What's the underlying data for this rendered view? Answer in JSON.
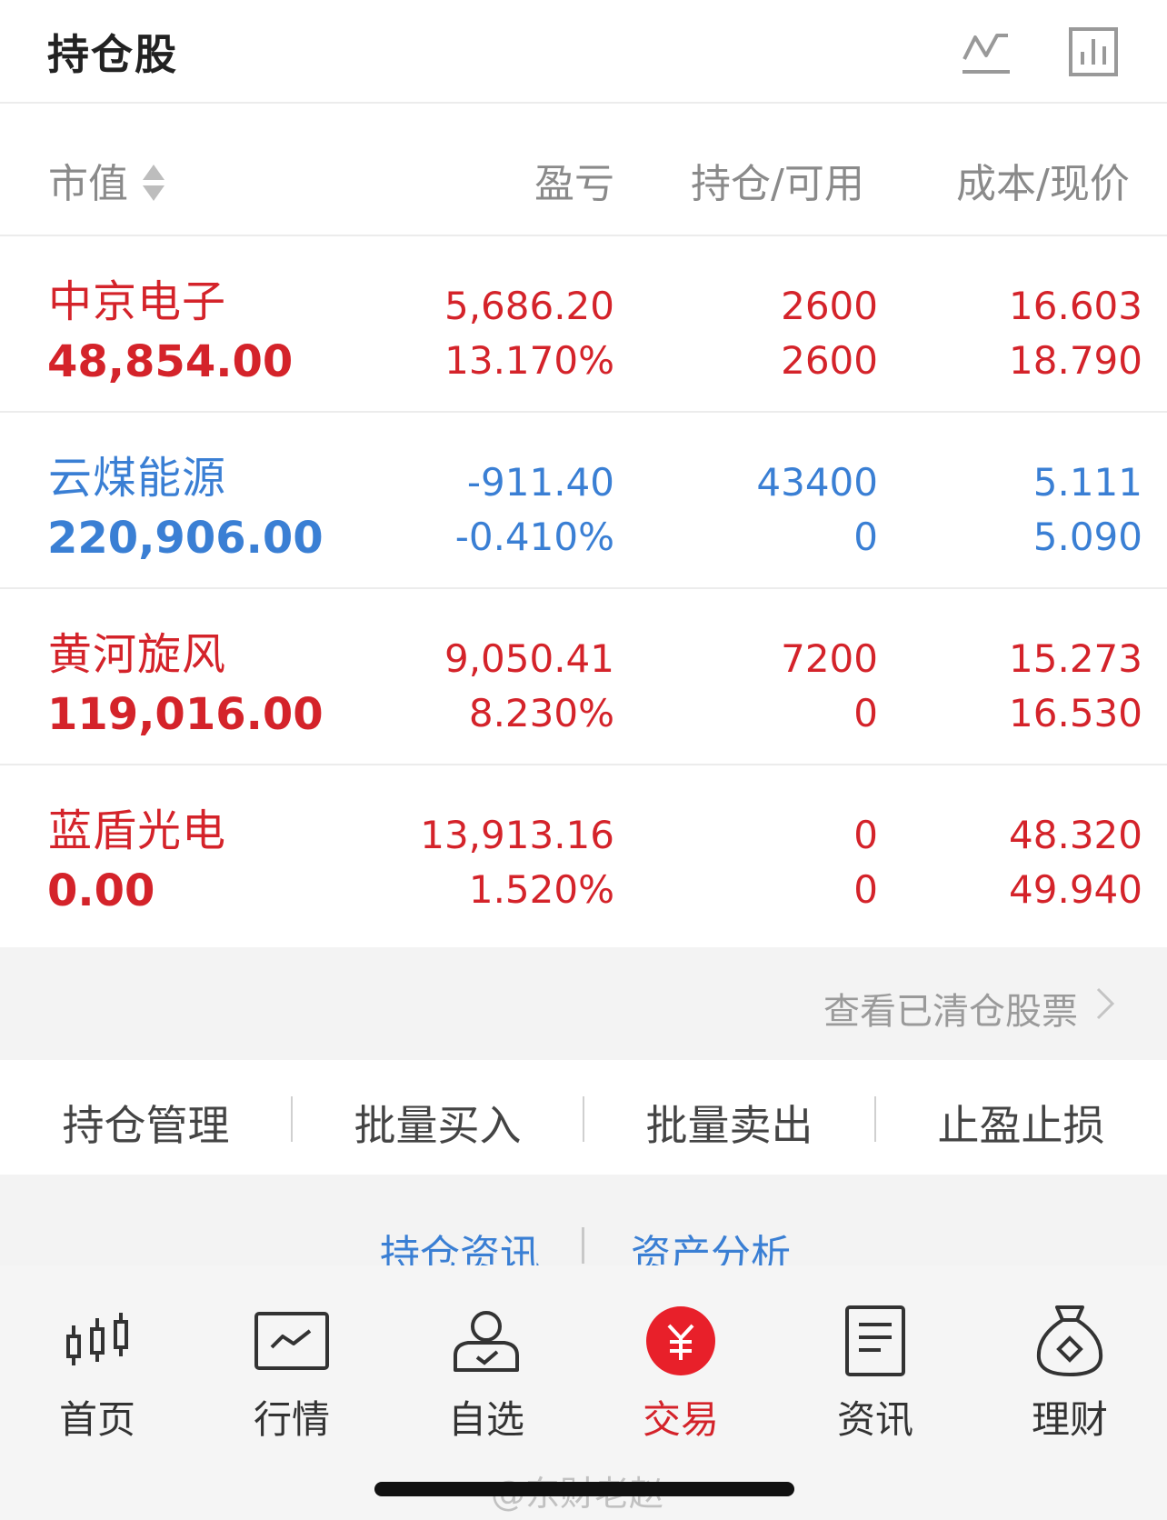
{
  "header": {
    "title": "持仓股",
    "icons": [
      "line-chart-icon",
      "bar-chart-icon"
    ]
  },
  "columns": {
    "market_value": "市值",
    "pnl": "盈亏",
    "position": "持仓/可用",
    "price": "成本/现价"
  },
  "colors": {
    "up": "#d4232a",
    "down": "#3a7fd4",
    "accent": "#e8202a"
  },
  "holdings": [
    {
      "name": "中京电子",
      "market_value": "48,854.00",
      "pnl": "5,686.20",
      "pnl_pct": "13.170%",
      "position": "2600",
      "available": "2600",
      "cost": "16.603",
      "price": "18.790",
      "trend": "up"
    },
    {
      "name": "云煤能源",
      "market_value": "220,906.00",
      "pnl": "-911.40",
      "pnl_pct": "-0.410%",
      "position": "43400",
      "available": "0",
      "cost": "5.111",
      "price": "5.090",
      "trend": "down"
    },
    {
      "name": "黄河旋风",
      "market_value": "119,016.00",
      "pnl": "9,050.41",
      "pnl_pct": "8.230%",
      "position": "7200",
      "available": "0",
      "cost": "15.273",
      "price": "16.530",
      "trend": "up"
    },
    {
      "name": "蓝盾光电",
      "market_value": "0.00",
      "pnl": "13,913.16",
      "pnl_pct": "1.520%",
      "position": "0",
      "available": "0",
      "cost": "48.320",
      "price": "49.940",
      "trend": "up"
    }
  ],
  "cleared_link": "查看已清仓股票",
  "actions": [
    "持仓管理",
    "批量买入",
    "批量卖出",
    "止盈止损"
  ],
  "lower_links": [
    "持仓资讯",
    "资产分析"
  ],
  "tabs": [
    {
      "label": "首页",
      "icon": "candlestick-icon"
    },
    {
      "label": "行情",
      "icon": "market-chart-icon"
    },
    {
      "label": "自选",
      "icon": "user-check-icon"
    },
    {
      "label": "交易",
      "icon": "yuan-icon",
      "active": true
    },
    {
      "label": "资讯",
      "icon": "document-icon"
    },
    {
      "label": "理财",
      "icon": "money-bag-icon"
    }
  ],
  "watermark": "@东财老赵"
}
